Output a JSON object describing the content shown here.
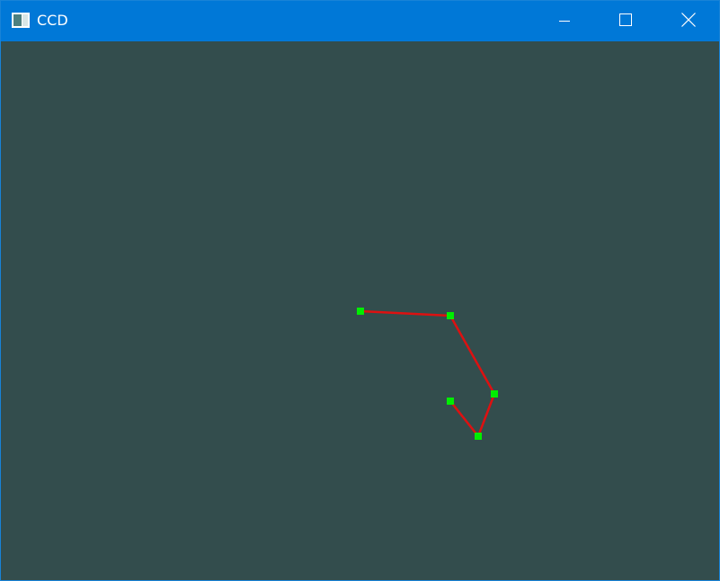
{
  "window": {
    "title": "CCD",
    "icon": "app-window-icon",
    "controls": {
      "minimize_icon": "minimize-icon",
      "maximize_icon": "maximize-icon",
      "close_icon": "close-icon"
    }
  },
  "scene": {
    "background_color": "#334d4d",
    "segment_color": "#dd1111",
    "joint_color": "#00ee00",
    "joint_count": 5,
    "segment_count": 4
  }
}
